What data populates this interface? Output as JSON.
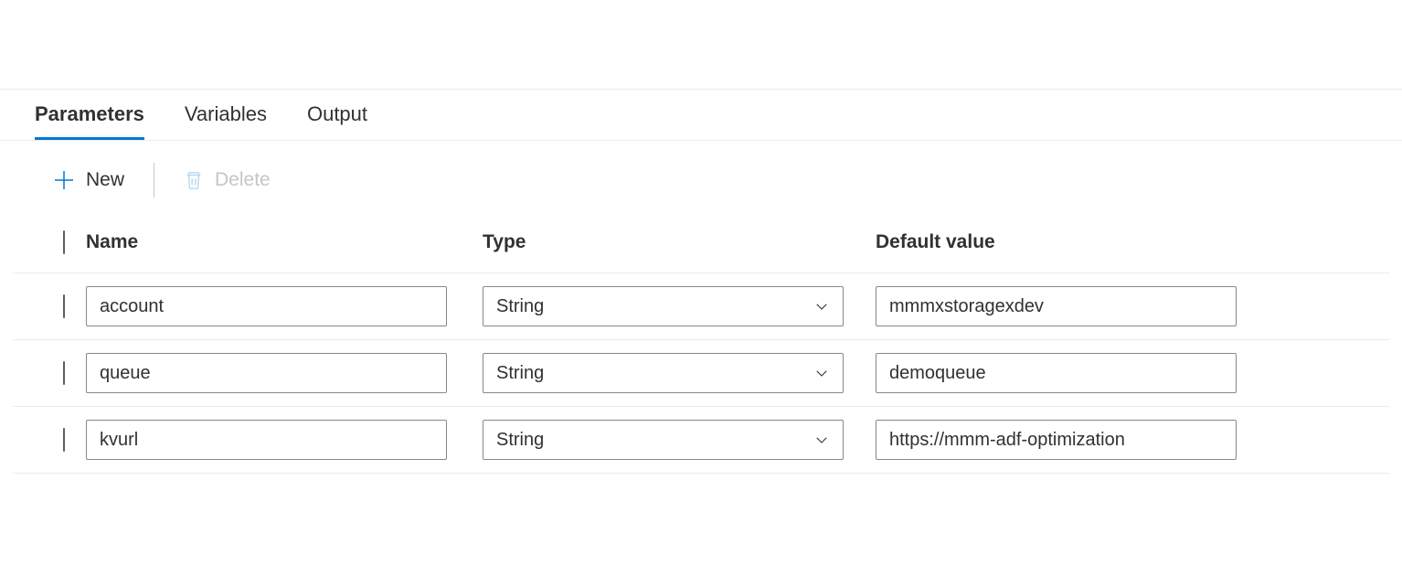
{
  "tabs": {
    "parameters": "Parameters",
    "variables": "Variables",
    "output": "Output"
  },
  "toolbar": {
    "new_label": "New",
    "delete_label": "Delete"
  },
  "table": {
    "headers": {
      "name": "Name",
      "type": "Type",
      "default_value": "Default value"
    },
    "rows": [
      {
        "name": "account",
        "type": "String",
        "default": "mmmxstoragexdev"
      },
      {
        "name": "queue",
        "type": "String",
        "default": "demoqueue"
      },
      {
        "name": "kvurl",
        "type": "String",
        "default": "https://mmm-adf-optimization"
      }
    ]
  }
}
